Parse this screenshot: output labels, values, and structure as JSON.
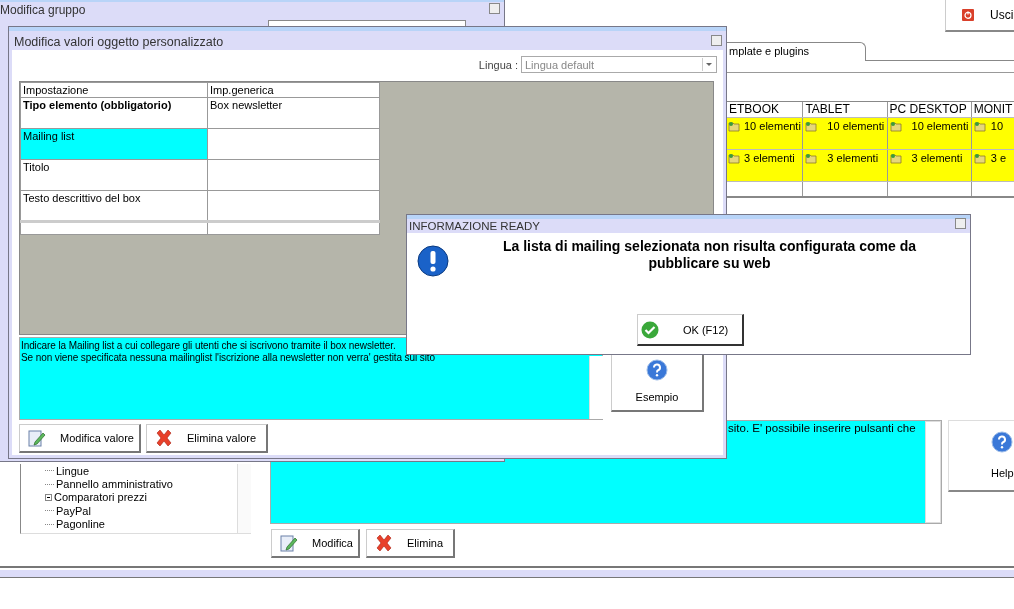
{
  "main_window": {
    "exit_button": "Usci",
    "tabs": [
      {
        "label": "mplate e plugins",
        "selected": true
      }
    ],
    "grid": {
      "columns": [
        "ETBOOK",
        "TABLET",
        "PC DESKTOP",
        "MONIT"
      ],
      "rows": [
        [
          "10 elementi",
          "10 elementi",
          "10 elementi",
          "10"
        ],
        [
          "3 elementi",
          "3 elementi",
          "3 elementi",
          "3 e"
        ]
      ]
    },
    "description": "sito. E' possibile inserire pulsanti che",
    "help_button": "Help",
    "buttons": [
      {
        "label": "Modifica",
        "kind": "edit"
      },
      {
        "label": "Elimina",
        "kind": "delete"
      }
    ],
    "tree": [
      {
        "label": "Lingue",
        "expandable": false
      },
      {
        "label": "Pannello amministrativo",
        "expandable": false
      },
      {
        "label": "Comparatori prezzi",
        "expandable": true
      },
      {
        "label": "PayPal",
        "expandable": false
      },
      {
        "label": "Pagonline",
        "expandable": false
      }
    ]
  },
  "group_window": {
    "title": "Modifica gruppo"
  },
  "edit_window": {
    "title": "Modifica valori oggetto personalizzato",
    "language_label": "Lingua :",
    "language_value": "Lingua default",
    "table": {
      "columns": [
        "Impostazione",
        "Imp.generica"
      ],
      "rows": [
        {
          "setting": "Tipo elemento (obbligatorio)",
          "value": "Box newsletter",
          "required": true,
          "selected": false
        },
        {
          "setting": "Mailing list",
          "required": false,
          "selected": true
        },
        {
          "setting": "Titolo",
          "required": false,
          "selected": false
        },
        {
          "setting": "Testo descrittivo del box",
          "required": false,
          "selected": false
        }
      ]
    },
    "description": "Indicare la Mailing list a cui collegare gli utenti che si iscrivono tramite il box newsletter.\nSe non viene specificata nessuna mailinglist l'iscrizione alla newsletter non verra' gestita sul sito",
    "example_button": "Esempio",
    "buttons": [
      {
        "label": "Modifica valore",
        "kind": "edit"
      },
      {
        "label": "Elimina valore",
        "kind": "delete"
      }
    ]
  },
  "dialog": {
    "title": "INFORMAZIONE READY",
    "message": "La lista di mailing selezionata non risulta configurata come da pubblicare su web",
    "ok_button": "OK (F12)"
  }
}
